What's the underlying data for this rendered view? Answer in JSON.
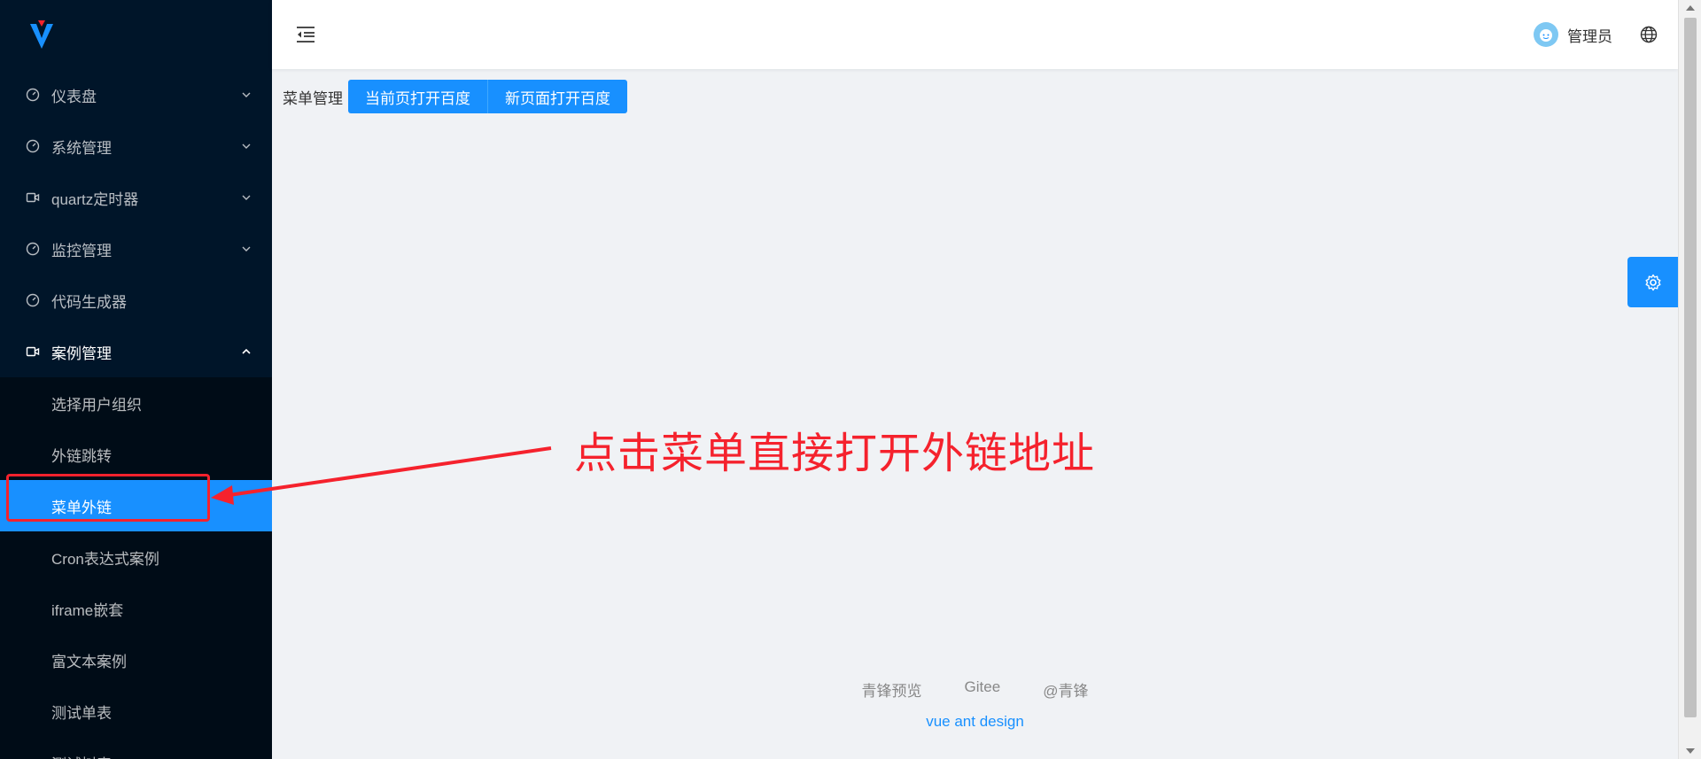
{
  "sidebar": {
    "menu": [
      {
        "label": "仪表盘",
        "icon": "dashboard-icon",
        "expanded": false
      },
      {
        "label": "系统管理",
        "icon": "dashboard-icon",
        "expanded": false
      },
      {
        "label": "quartz定时器",
        "icon": "video-camera-icon",
        "expanded": false
      },
      {
        "label": "监控管理",
        "icon": "dashboard-icon",
        "expanded": false
      },
      {
        "label": "代码生成器",
        "icon": "dashboard-icon",
        "expanded": false
      },
      {
        "label": "案例管理",
        "icon": "video-camera-icon",
        "expanded": true
      }
    ],
    "submenu": [
      {
        "label": "选择用户组织"
      },
      {
        "label": "外链跳转"
      },
      {
        "label": "菜单外链",
        "active": true
      },
      {
        "label": "Cron表达式案例"
      },
      {
        "label": "iframe嵌套"
      },
      {
        "label": "富文本案例"
      },
      {
        "label": "测试单表"
      },
      {
        "label": "测试树表"
      }
    ]
  },
  "header": {
    "user_name": "管理员"
  },
  "toolbar": {
    "crumb": "菜单管理",
    "btn_current": "当前页打开百度",
    "btn_new": "新页面打开百度"
  },
  "annotation": {
    "text": "点击菜单直接打开外链地址"
  },
  "footer": {
    "links": [
      "青锋预览",
      "Gitee",
      "@青锋"
    ],
    "copy": "vue ant design"
  },
  "colors": {
    "sidebar_bg": "#001529",
    "primary": "#1890ff",
    "annotation": "#f5222d"
  }
}
